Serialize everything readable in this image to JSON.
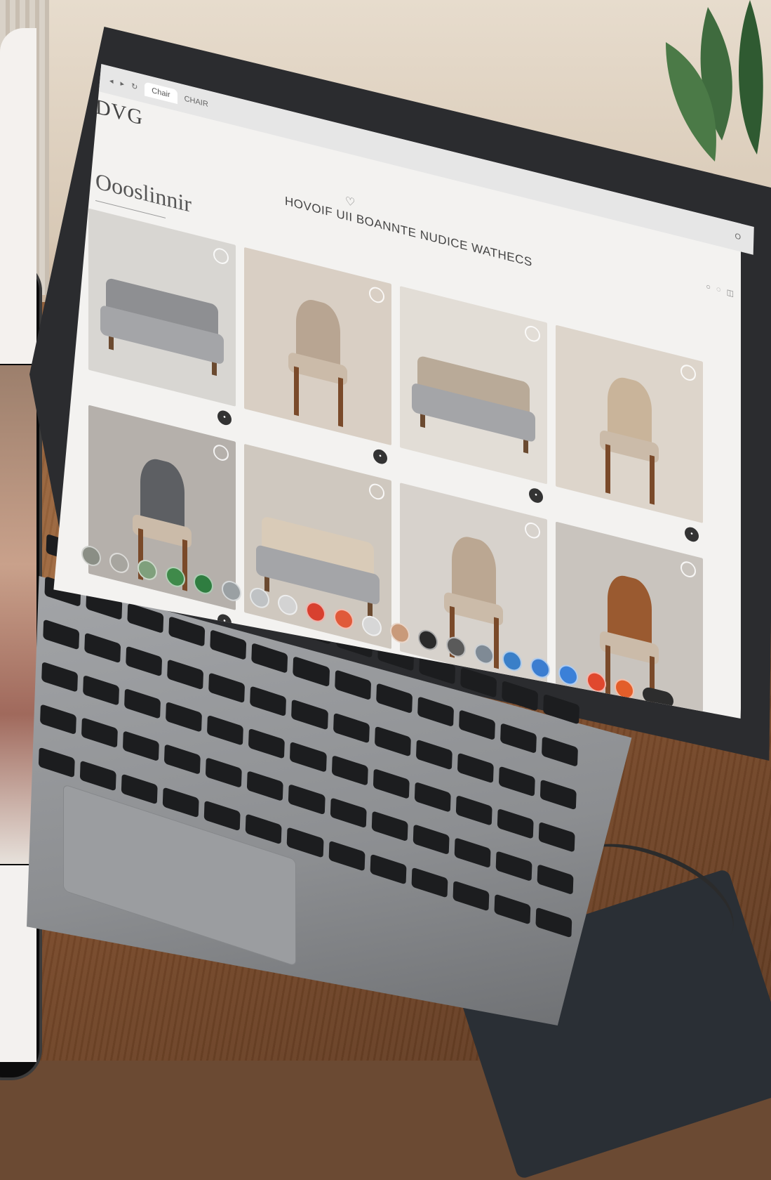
{
  "browser": {
    "tab_label": "Chair",
    "address": "CHAIR",
    "right_tab": "O"
  },
  "site": {
    "logo": "DVG",
    "sub_logo": "",
    "nav": [
      "",
      "",
      "",
      ""
    ],
    "headline": "HOVOIF UII BOANNTE NUDICE WATHECS",
    "banner_title": "Oooslinnir",
    "header_right": [
      "",
      ""
    ]
  },
  "products": [
    {
      "caption": "",
      "price": "",
      "tag": "",
      "img": "#d8d6d2",
      "kind": "sofa",
      "fabric": "#8e8f92"
    },
    {
      "caption": "",
      "price": "",
      "tag": "",
      "img": "#d9cfc4",
      "kind": "chair",
      "fabric": "#b8a592"
    },
    {
      "caption": "",
      "price": "",
      "tag": "",
      "img": "#e2ddd6",
      "kind": "sofa",
      "fabric": "#b9aa98"
    },
    {
      "caption": "",
      "price": "",
      "tag": "",
      "img": "#ddd5cb",
      "kind": "chair",
      "fabric": "#c9b49a"
    },
    {
      "caption": "",
      "price": "",
      "tag": "",
      "img": "#b5b0ab",
      "kind": "chair",
      "fabric": "#5d5f63"
    },
    {
      "caption": "",
      "price": "",
      "tag": "",
      "img": "#cfc8bf",
      "kind": "sofa",
      "fabric": "#d9cbb8"
    },
    {
      "caption": "",
      "price": "",
      "tag": "",
      "img": "#d7d2cc",
      "kind": "chair",
      "fabric": "#bba792"
    },
    {
      "caption": "",
      "price": "",
      "tag": "",
      "img": "#c9c4be",
      "kind": "chair",
      "fabric": "#9a5a30"
    }
  ],
  "swatches": [
    "#8a8e85",
    "#a7a59f",
    "#7fa07c",
    "#3f8a4a",
    "#2f7d40",
    "#9aa0a3",
    "#bfc2c4",
    "#d3d3d3",
    "#d8402f",
    "#e05a3a",
    "#d7d7d7",
    "#c99a7a",
    "#2a2a2a",
    "#5a5a5a",
    "#7f8a95",
    "#3a7fc8",
    "#3b7dd0",
    "#3b80d8",
    "#e0482e",
    "#e35e2a"
  ]
}
